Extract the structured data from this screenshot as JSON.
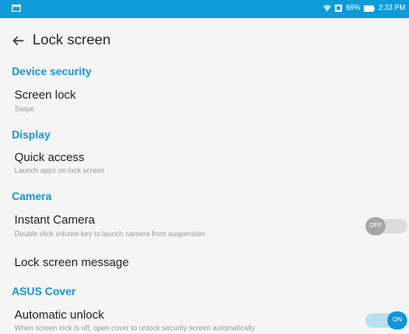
{
  "status_bar": {
    "battery_percent": "69%",
    "time": "2:33 PM",
    "color": "#0f9bd7"
  },
  "header": {
    "title": "Lock screen",
    "back_icon": "arrow-back-icon"
  },
  "sections": {
    "device_security": {
      "header": "Device security",
      "screen_lock": {
        "title": "Screen lock",
        "subtitle": "Swipe"
      }
    },
    "display": {
      "header": "Display",
      "quick_access": {
        "title": "Quick access",
        "subtitle": "Launch apps on lock screen"
      }
    },
    "camera": {
      "header": "Camera",
      "instant_camera": {
        "title": "Instant Camera",
        "subtitle": "Double click volume key to launch camera from suspension",
        "toggle_label": "OFF",
        "toggle_state": false
      },
      "lock_screen_message": {
        "title": "Lock screen message"
      }
    },
    "asus_cover": {
      "header": "ASUS Cover",
      "automatic_unlock": {
        "title": "Automatic unlock",
        "subtitle": "When screen lock is off, open cover to unlock security screen automatically",
        "toggle_label": "ON",
        "toggle_state": true
      }
    }
  },
  "colors": {
    "accent": "#1295d6",
    "background": "#f5f5f5"
  }
}
